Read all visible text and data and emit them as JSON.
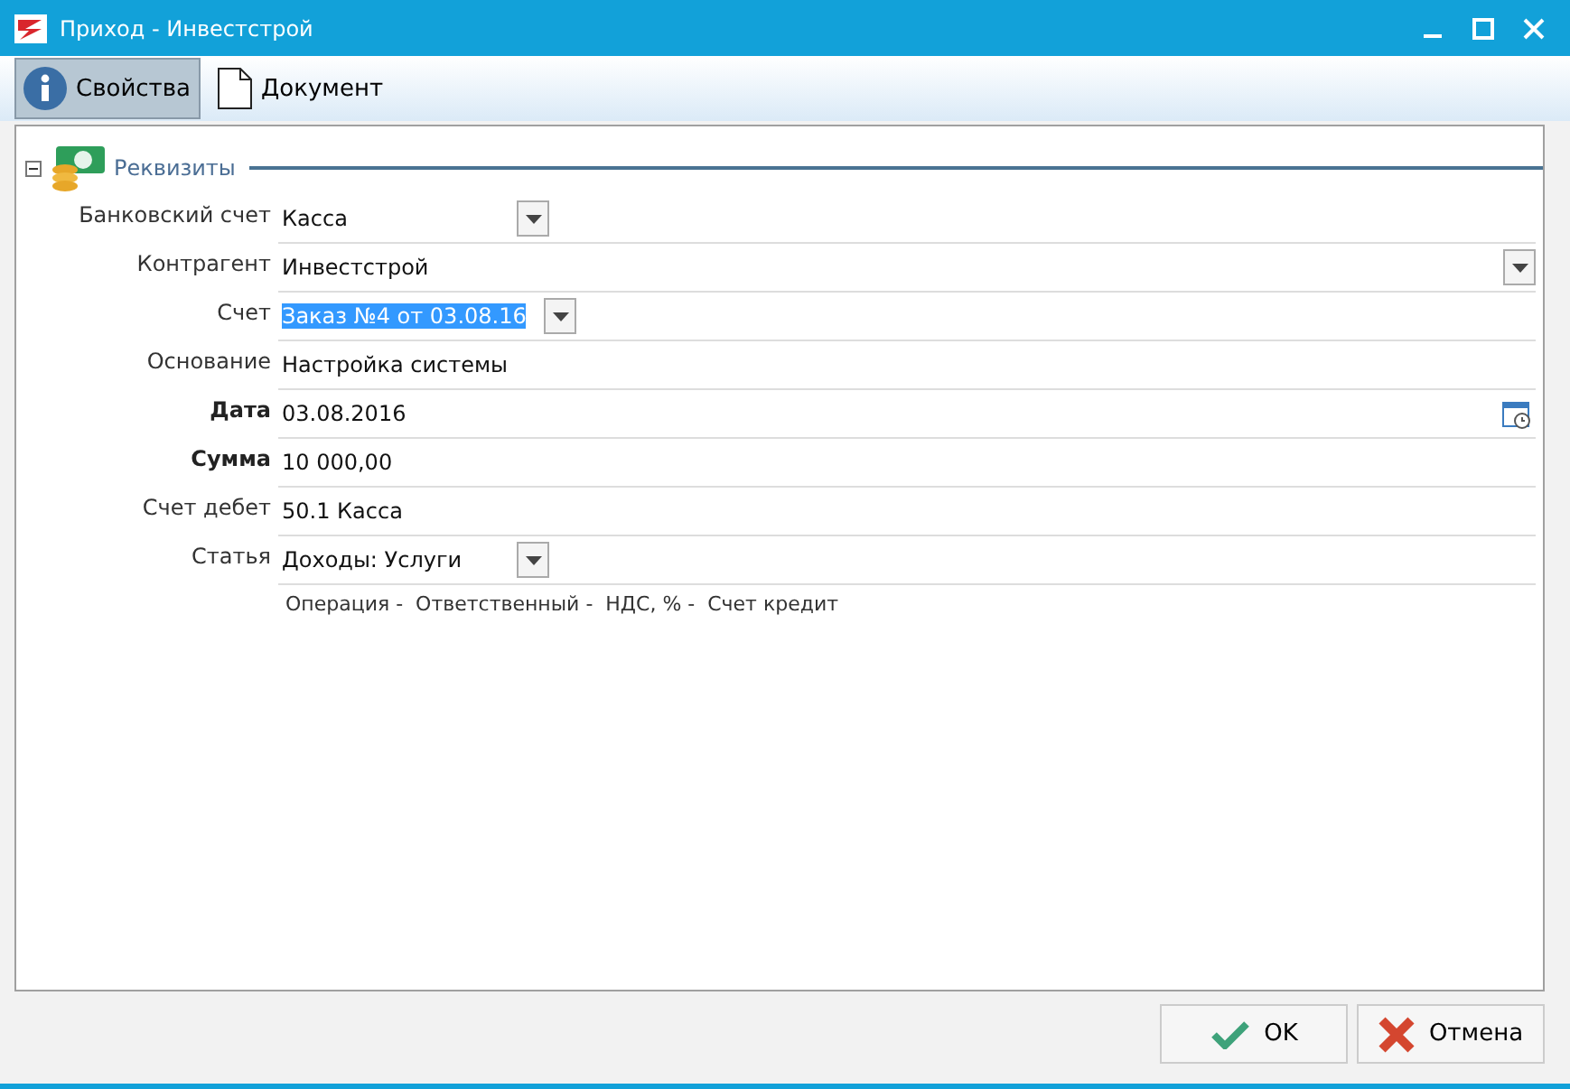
{
  "window": {
    "title": "Приход - Инвестстрой"
  },
  "tabs": [
    {
      "label": "Свойства",
      "selected": true,
      "kind": "info"
    },
    {
      "label": "Документ",
      "selected": false,
      "kind": "document"
    }
  ],
  "section": {
    "title": "Реквизиты",
    "expanded": true
  },
  "fields": [
    {
      "label": "Банковский счет",
      "value": "Касса",
      "kind": "combo",
      "required": false,
      "selected": false
    },
    {
      "label": "Контрагент",
      "value": "Инвестстрой",
      "kind": "combo_wide",
      "required": false,
      "selected": false
    },
    {
      "label": "Счет",
      "value": "Заказ №4 от 03.08.16",
      "kind": "combo",
      "required": false,
      "selected": true
    },
    {
      "label": "Основание",
      "value": "Настройка системы",
      "kind": "text",
      "required": false,
      "selected": false
    },
    {
      "label": "Дата",
      "value": "03.08.2016",
      "kind": "date",
      "required": true,
      "selected": false
    },
    {
      "label": "Сумма",
      "value": "10 000,00",
      "kind": "text",
      "required": true,
      "selected": false
    },
    {
      "label": "Счет дебет",
      "value": "50.1 Касса",
      "kind": "text",
      "required": false,
      "selected": false
    },
    {
      "label": "Статья",
      "value": "Доходы: Услуги",
      "kind": "combo",
      "required": false,
      "selected": false
    }
  ],
  "details": "Операция -  Ответственный -  НДС, % -  Счет кредит",
  "buttons": [
    {
      "label": "OK",
      "kind": "ok"
    },
    {
      "label": "Отмена",
      "kind": "cancel"
    }
  ]
}
